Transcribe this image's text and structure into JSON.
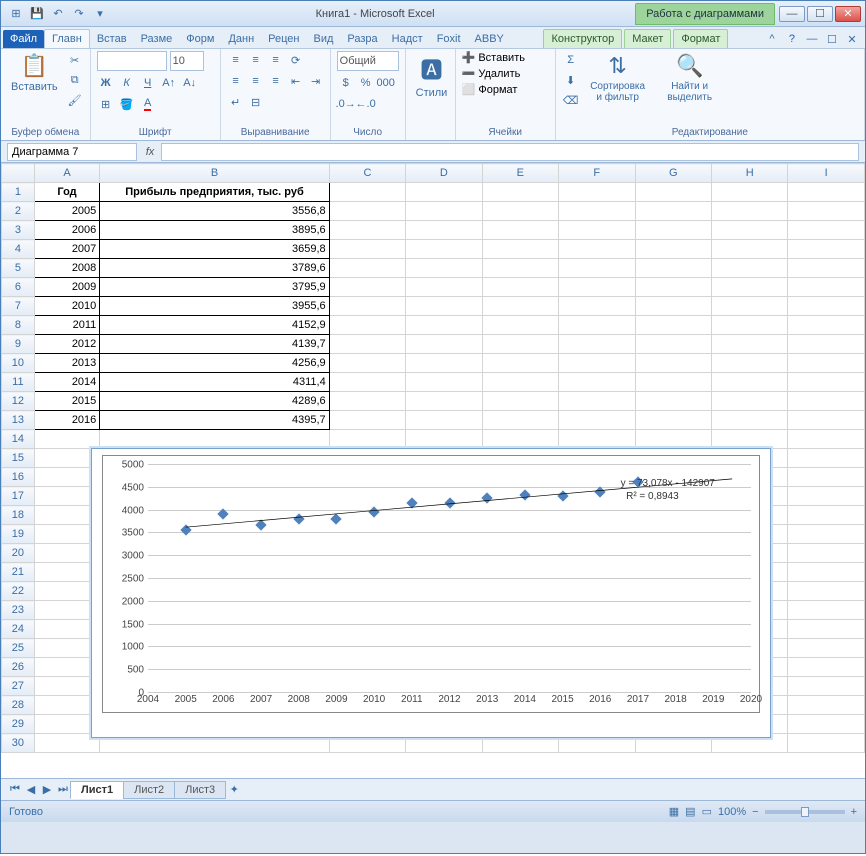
{
  "title": {
    "doc": "Книга1",
    "app": "Microsoft Excel",
    "context": "Работа с диаграммами"
  },
  "tabs": {
    "file": "Файл",
    "list": [
      "Главн",
      "Встав",
      "Разме",
      "Форм",
      "Данн",
      "Рецен",
      "Вид",
      "Разра",
      "Надст",
      "Foxit",
      "ABBY"
    ],
    "ctx": [
      "Конструктор",
      "Макет",
      "Формат"
    ]
  },
  "ribbon": {
    "clipboard": {
      "paste": "Вставить",
      "label": "Буфер обмена"
    },
    "font": {
      "size": "10",
      "label": "Шрифт"
    },
    "align": {
      "label": "Выравнивание"
    },
    "number": {
      "format": "Общий",
      "label": "Число"
    },
    "styles": {
      "btn": "Стили",
      "label": ""
    },
    "cells": {
      "insert": "Вставить",
      "delete": "Удалить",
      "format": "Формат",
      "label": "Ячейки"
    },
    "editing": {
      "sort": "Сортировка и фильтр",
      "find": "Найти и выделить",
      "label": "Редактирование"
    }
  },
  "namebox": "Диаграмма 7",
  "table": {
    "headers": [
      "Год",
      "Прибыль предприятия, тыс. руб"
    ],
    "rows": [
      [
        "2005",
        "3556,8"
      ],
      [
        "2006",
        "3895,6"
      ],
      [
        "2007",
        "3659,8"
      ],
      [
        "2008",
        "3789,6"
      ],
      [
        "2009",
        "3795,9"
      ],
      [
        "2010",
        "3955,6"
      ],
      [
        "2011",
        "4152,9"
      ],
      [
        "2012",
        "4139,7"
      ],
      [
        "2013",
        "4256,9"
      ],
      [
        "2014",
        "4311,4"
      ],
      [
        "2015",
        "4289,6"
      ],
      [
        "2016",
        "4395,7"
      ]
    ]
  },
  "chart_data": {
    "type": "scatter",
    "x": [
      2005,
      2006,
      2007,
      2008,
      2009,
      2010,
      2011,
      2012,
      2013,
      2014,
      2015,
      2016,
      2017
    ],
    "y": [
      3556.8,
      3895.6,
      3659.8,
      3789.6,
      3795.9,
      3955.6,
      4152.9,
      4139.7,
      4256.9,
      4311.4,
      4289.6,
      4395.7,
      4600
    ],
    "xlim": [
      2004,
      2020
    ],
    "ylim": [
      0,
      5000
    ],
    "xticks": [
      2004,
      2005,
      2006,
      2007,
      2008,
      2009,
      2010,
      2011,
      2012,
      2013,
      2014,
      2015,
      2016,
      2017,
      2018,
      2019,
      2020
    ],
    "yticks": [
      0,
      500,
      1000,
      1500,
      2000,
      2500,
      3000,
      3500,
      4000,
      4500,
      5000
    ],
    "trendline": {
      "equation": "y = 73,078x - 142907",
      "r2": "R² = 0,8943"
    }
  },
  "sheets": {
    "list": [
      "Лист1",
      "Лист2",
      "Лист3"
    ],
    "active": 0
  },
  "status": {
    "ready": "Готово",
    "zoom": "100%"
  },
  "cols": [
    "A",
    "B",
    "C",
    "D",
    "E",
    "F",
    "G",
    "H",
    "I"
  ]
}
